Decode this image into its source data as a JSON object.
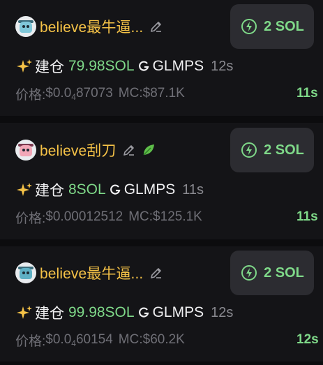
{
  "feed": {
    "items": [
      {
        "name": "believe最牛逼...",
        "has_leaf": false,
        "buy_label": "2 SOL",
        "action": "建仓",
        "sol_amount": "79.98SOL",
        "token": "GLMPS",
        "age": "12s",
        "price_label": "价格:",
        "price_prefix": "$0.0",
        "price_zeros": "4",
        "price_digits": "87073",
        "mc": "MC:$87.1K",
        "elapsed": "11s"
      },
      {
        "name": "believe刮刀",
        "has_leaf": true,
        "buy_label": "2 SOL",
        "action": "建仓",
        "sol_amount": "8SOL",
        "token": "GLMPS",
        "age": "11s",
        "price_label": "价格:",
        "price_prefix": "$0.00012512",
        "price_zeros": "",
        "price_digits": "",
        "mc": "MC:$125.1K",
        "elapsed": "11s"
      },
      {
        "name": "believe最牛逼...",
        "has_leaf": false,
        "buy_label": "2 SOL",
        "action": "建仓",
        "sol_amount": "99.98SOL",
        "token": "GLMPS",
        "age": "12s",
        "price_label": "价格:",
        "price_prefix": "$0.0",
        "price_zeros": "4",
        "price_digits": "60154",
        "mc": "MC:$60.2K",
        "elapsed": "12s"
      }
    ]
  },
  "icons": {
    "avatar": "avatar-icon",
    "edit": "pencil-icon",
    "leaf": "leaf-icon",
    "bolt": "lightning-icon",
    "sparkle": "sparkle-icon",
    "token": "token-g-icon"
  },
  "colors": {
    "background": "#141417",
    "name": "#f5c247",
    "green": "#7fd989",
    "button_bg": "#2c2c31",
    "muted": "#6f6f76"
  }
}
